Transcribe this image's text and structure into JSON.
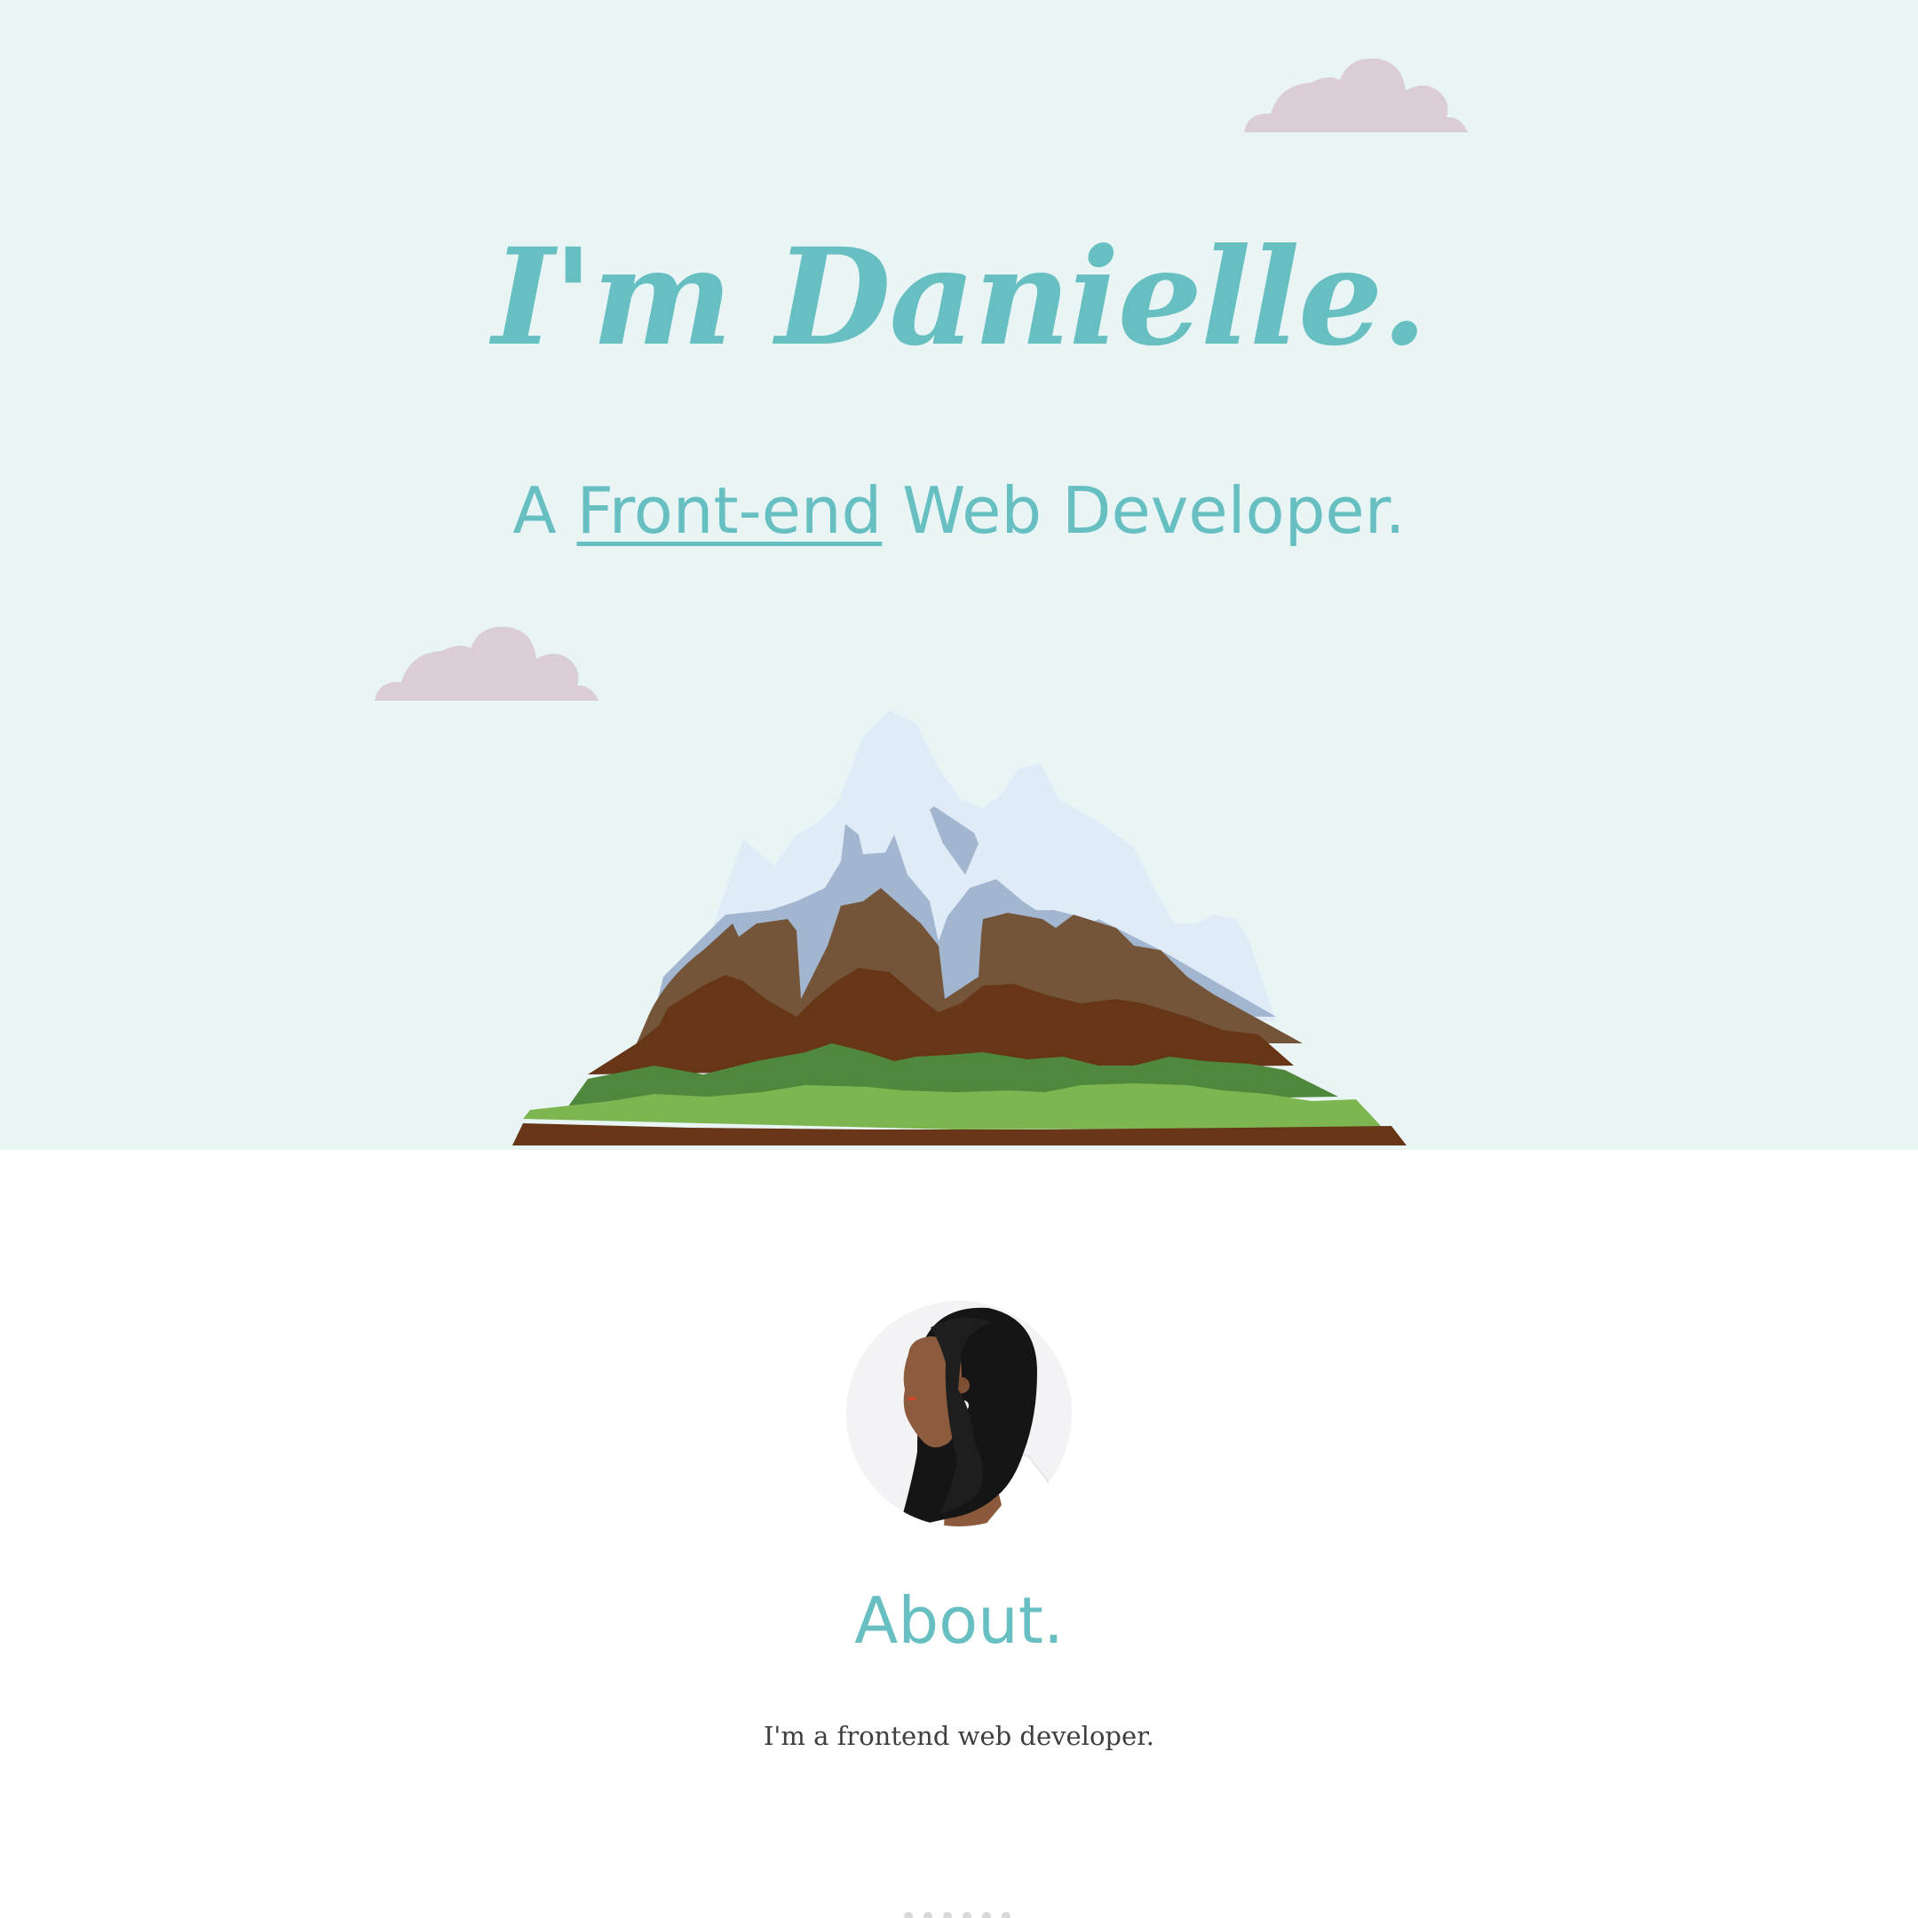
{
  "hero": {
    "title": "I'm Danielle.",
    "subtitle_prefix": "A ",
    "subtitle_link": "Front-end",
    "subtitle_suffix": " Web Developer.",
    "background_color": "#e8f5f4",
    "accent_color": "#67bfc2",
    "cloud_color": "#dbcdd4"
  },
  "about": {
    "heading": "About.",
    "body": "I'm a frontend web developer.",
    "avatar_alt": "avatar-photo"
  }
}
